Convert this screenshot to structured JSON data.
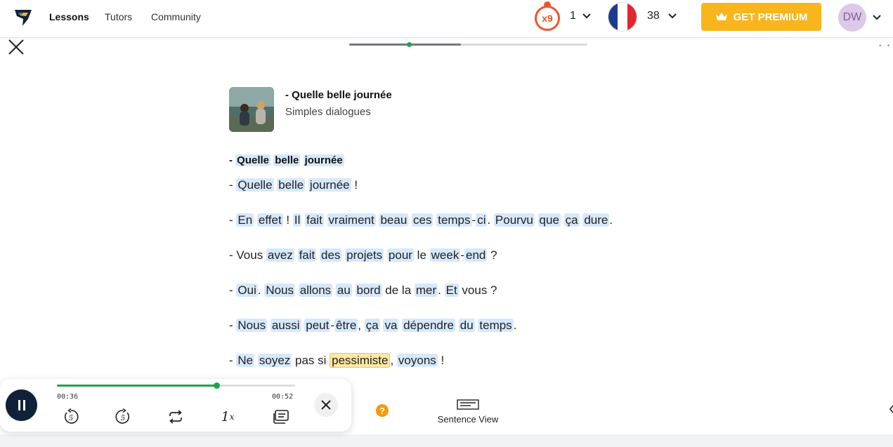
{
  "nav": {
    "links": [
      "Lessons",
      "Tutors",
      "Community"
    ],
    "streak_badge": "x9",
    "streak_count": "1",
    "language_count": "38",
    "premium_label": "GET PREMIUM",
    "avatar_initials": "DW"
  },
  "lesson": {
    "progress": 0.47,
    "position_marker": 0.25,
    "title": "- Quelle belle journée",
    "subtitle": "Simples dialogues"
  },
  "dialogue": {
    "heading": [
      {
        "t": "- ",
        "w": false
      },
      {
        "t": "Quelle",
        "w": true
      },
      {
        "t": " ",
        "w": false
      },
      {
        "t": "belle",
        "w": true
      },
      {
        "t": " ",
        "w": false
      },
      {
        "t": "journée",
        "w": true
      }
    ],
    "lines": [
      [
        {
          "t": "- ",
          "w": false
        },
        {
          "t": "Quelle",
          "w": true
        },
        {
          "t": " ",
          "w": false
        },
        {
          "t": "belle",
          "w": true
        },
        {
          "t": " ",
          "w": false
        },
        {
          "t": "journée",
          "w": true
        },
        {
          "t": " !",
          "w": false
        }
      ],
      [
        {
          "t": "- ",
          "w": false
        },
        {
          "t": "En",
          "w": true
        },
        {
          "t": " ",
          "w": false
        },
        {
          "t": "effet",
          "w": true
        },
        {
          "t": " ! ",
          "w": false
        },
        {
          "t": "Il",
          "w": true
        },
        {
          "t": " ",
          "w": false
        },
        {
          "t": "fait",
          "w": true
        },
        {
          "t": " ",
          "w": false
        },
        {
          "t": "vraiment",
          "w": true
        },
        {
          "t": " ",
          "w": false
        },
        {
          "t": "beau",
          "w": true
        },
        {
          "t": " ",
          "w": false
        },
        {
          "t": "ces",
          "w": true
        },
        {
          "t": " ",
          "w": false
        },
        {
          "t": "temps",
          "w": true
        },
        {
          "t": "-",
          "w": false
        },
        {
          "t": "ci",
          "w": true
        },
        {
          "t": ". ",
          "w": false
        },
        {
          "t": "Pourvu",
          "w": true
        },
        {
          "t": " ",
          "w": false
        },
        {
          "t": "que",
          "w": true
        },
        {
          "t": " ",
          "w": false
        },
        {
          "t": "ça",
          "w": true
        },
        {
          "t": " ",
          "w": false
        },
        {
          "t": "dure",
          "w": true
        },
        {
          "t": ".",
          "w": false
        }
      ],
      [
        {
          "t": "- Vous ",
          "w": false
        },
        {
          "t": "avez",
          "w": true
        },
        {
          "t": " ",
          "w": false
        },
        {
          "t": "fait",
          "w": true
        },
        {
          "t": " ",
          "w": false
        },
        {
          "t": "des",
          "w": true
        },
        {
          "t": " ",
          "w": false
        },
        {
          "t": "projets",
          "w": true
        },
        {
          "t": " ",
          "w": false
        },
        {
          "t": "pour",
          "w": true
        },
        {
          "t": " le ",
          "w": false
        },
        {
          "t": "week",
          "w": true
        },
        {
          "t": "-",
          "w": false
        },
        {
          "t": "end",
          "w": true
        },
        {
          "t": " ?",
          "w": false
        }
      ],
      [
        {
          "t": "- ",
          "w": false
        },
        {
          "t": "Oui",
          "w": true
        },
        {
          "t": ". ",
          "w": false
        },
        {
          "t": "Nous",
          "w": true
        },
        {
          "t": " ",
          "w": false
        },
        {
          "t": "allons",
          "w": true
        },
        {
          "t": " ",
          "w": false
        },
        {
          "t": "au",
          "w": true
        },
        {
          "t": " ",
          "w": false
        },
        {
          "t": "bord",
          "w": true
        },
        {
          "t": " de la ",
          "w": false
        },
        {
          "t": "mer",
          "w": true
        },
        {
          "t": ". ",
          "w": false
        },
        {
          "t": "Et",
          "w": true
        },
        {
          "t": " vous ?",
          "w": false
        }
      ],
      [
        {
          "t": "- ",
          "w": false
        },
        {
          "t": "Nous",
          "w": true
        },
        {
          "t": " ",
          "w": false
        },
        {
          "t": "aussi",
          "w": true
        },
        {
          "t": " ",
          "w": false
        },
        {
          "t": "peut",
          "w": true
        },
        {
          "t": "-",
          "w": false
        },
        {
          "t": "être",
          "w": true
        },
        {
          "t": ", ",
          "w": false
        },
        {
          "t": "ça",
          "w": true
        },
        {
          "t": " ",
          "w": false
        },
        {
          "t": "va",
          "w": true
        },
        {
          "t": " ",
          "w": false
        },
        {
          "t": "dépendre",
          "w": true
        },
        {
          "t": " ",
          "w": false
        },
        {
          "t": "du",
          "w": true
        },
        {
          "t": " ",
          "w": false
        },
        {
          "t": "temps",
          "w": true
        },
        {
          "t": ".",
          "w": false
        }
      ],
      [
        {
          "t": "- ",
          "w": false
        },
        {
          "t": "Ne",
          "w": true
        },
        {
          "t": " ",
          "w": false
        },
        {
          "t": "soyez",
          "w": true
        },
        {
          "t": " pas si ",
          "w": false
        },
        {
          "t": "pessimiste",
          "w": true,
          "hl": true
        },
        {
          "t": ", ",
          "w": false
        },
        {
          "t": "voyons",
          "w": true
        },
        {
          "t": " !",
          "w": false
        }
      ]
    ]
  },
  "player": {
    "elapsed": "00:36",
    "duration": "00:52",
    "played_fraction": 0.67,
    "speed": "1",
    "speed_suffix": "x"
  },
  "toolbar": {
    "help_label": "?",
    "sentence_view_label": "Sentence View"
  },
  "colors": {
    "word_bg": "#d6e8fb",
    "highlight_bg": "#fde8a3",
    "premium": "#f9b51c",
    "streak": "#f0542d",
    "progress_green": "#1fa34a",
    "player_button": "#0f2238"
  },
  "icons": [
    "logo-icon",
    "chevron-down-icon",
    "crown-icon",
    "close-icon",
    "pause-icon",
    "rewind-5-icon",
    "forward-5-icon",
    "repeat-icon",
    "subtitles-icon",
    "help-icon",
    "sentence-view-icon"
  ]
}
